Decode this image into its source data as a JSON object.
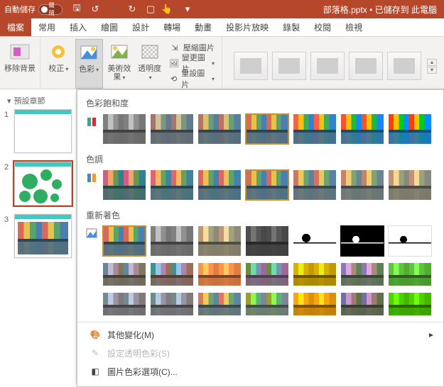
{
  "titlebar": {
    "autosave_label": "自動儲存",
    "toggle_state": "關閉",
    "file_status": "部落格.pptx • 已儲存到 此電腦"
  },
  "tabs": {
    "file": "檔案",
    "home": "常用",
    "insert": "插入",
    "draw": "繪圖",
    "design": "設計",
    "transition": "轉場",
    "animation": "動畫",
    "slideshow": "投影片放映",
    "record": "錄製",
    "review": "校閱",
    "view": "檢視"
  },
  "ribbon": {
    "remove_bg": "移除背景",
    "corrections": "校正",
    "color": "色彩",
    "artistic": "美術效果",
    "transparency": "透明度",
    "compress": "壓縮圖片",
    "change": "變更圖片",
    "reset": "重設圖片"
  },
  "panel": {
    "section": "預設章節",
    "s1": "1",
    "s2": "2",
    "s3": "3"
  },
  "dropdown": {
    "saturation": "色彩飽和度",
    "tone": "色調",
    "recolor": "重新著色",
    "more": "其他變化(M)",
    "set_transparent": "設定透明色彩(S)",
    "color_options": "圖片色彩選項(C)..."
  }
}
